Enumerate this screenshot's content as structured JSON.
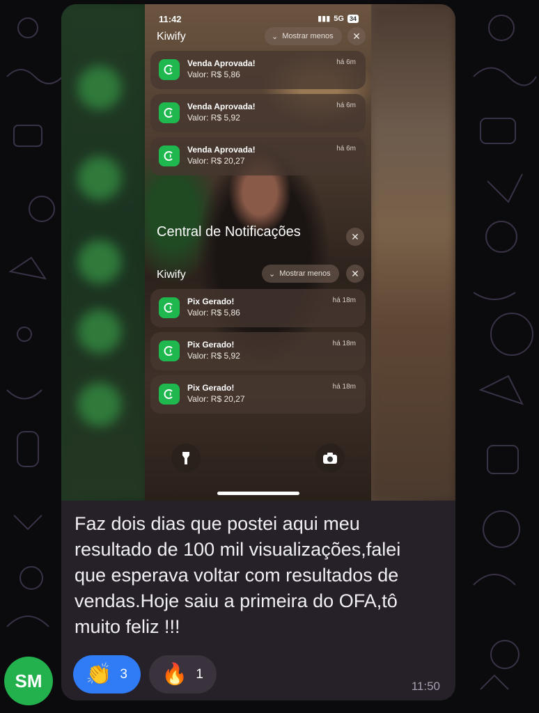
{
  "colors": {
    "background": "#0b0b0d",
    "bubble": "#262129",
    "reaction_active": "#2f7cf6",
    "avatar": "#23b14d",
    "kiwify_icon": "#1fb84f"
  },
  "phone": {
    "status": {
      "time": "11:42",
      "network": "5G",
      "battery": "34"
    },
    "top_group": {
      "app_name": "Kiwify",
      "show_less_label": "Mostrar menos",
      "notifications": [
        {
          "title": "Venda Aprovada!",
          "value": "Valor: R$ 5,86",
          "time": "há 6m"
        },
        {
          "title": "Venda Aprovada!",
          "value": "Valor: R$ 5,92",
          "time": "há 6m"
        },
        {
          "title": "Venda Aprovada!",
          "value": "Valor: R$ 20,27",
          "time": "há 6m"
        }
      ]
    },
    "notification_center_title": "Central de Notificações",
    "bottom_group": {
      "app_name": "Kiwify",
      "show_less_label": "Mostrar menos",
      "notifications": [
        {
          "title": "Pix Gerado!",
          "value": "Valor: R$ 5,86",
          "time": "há 18m"
        },
        {
          "title": "Pix Gerado!",
          "value": "Valor: R$ 5,92",
          "time": "há 18m"
        },
        {
          "title": "Pix Gerado!",
          "value": "Valor: R$ 20,27",
          "time": "há 18m"
        }
      ]
    }
  },
  "message": {
    "lines": [
      "Faz dois dias que postei aqui meu",
      "resultado de 100 mil visualizações,falei",
      "que esperava voltar com resultados de",
      "vendas.Hoje saiu a primeira do OFA,tô",
      "muito feliz !!!"
    ],
    "time": "11:50",
    "reactions": [
      {
        "emoji": "👏",
        "count": "3",
        "icon": "clapping-hands-icon"
      },
      {
        "emoji": "🔥",
        "count": "1",
        "icon": "fire-icon"
      }
    ]
  },
  "sender": {
    "initials": "SM"
  }
}
